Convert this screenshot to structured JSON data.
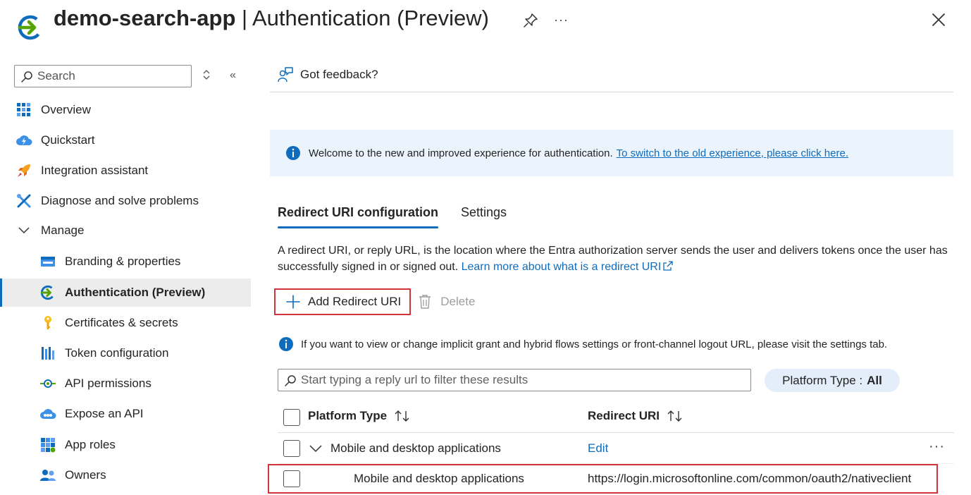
{
  "header": {
    "app_name": "demo-search-app",
    "separator": " | ",
    "page_name": "Authentication (Preview)",
    "more_label": "···"
  },
  "sidebar": {
    "search_placeholder": "Search",
    "collapse_label": "«",
    "items": [
      {
        "label": "Overview",
        "icon": "overview-grid-icon"
      },
      {
        "label": "Quickstart",
        "icon": "quickstart-cloud-icon"
      },
      {
        "label": "Integration assistant",
        "icon": "rocket-icon"
      },
      {
        "label": "Diagnose and solve problems",
        "icon": "wrench-icon"
      }
    ],
    "manage_label": "Manage",
    "manage_items": [
      {
        "label": "Branding & properties",
        "icon": "branding-icon"
      },
      {
        "label": "Authentication (Preview)",
        "icon": "authentication-icon",
        "active": true
      },
      {
        "label": "Certificates & secrets",
        "icon": "key-icon"
      },
      {
        "label": "Token configuration",
        "icon": "token-bars-icon"
      },
      {
        "label": "API permissions",
        "icon": "api-permissions-icon"
      },
      {
        "label": "Expose an API",
        "icon": "expose-api-cloud-icon"
      },
      {
        "label": "App roles",
        "icon": "app-roles-grid-icon"
      },
      {
        "label": "Owners",
        "icon": "owners-people-icon"
      }
    ]
  },
  "main": {
    "feedback_label": "Got feedback?",
    "banner": {
      "text": "Welcome to the new and improved experience for authentication.",
      "link": "To switch to the old experience, please click here."
    },
    "tabs": [
      {
        "label": "Redirect URI configuration",
        "active": true
      },
      {
        "label": "Settings",
        "active": false
      }
    ],
    "description": {
      "text": "A redirect URI, or reply URL, is the location where the Entra authorization server sends the user and delivers tokens once the user has successfully signed in or signed out.",
      "link": "Learn more about what is a redirect URI"
    },
    "commands": {
      "add_label": "Add Redirect URI",
      "delete_label": "Delete"
    },
    "info_text": "If you want to view or change implicit grant and hybrid flows settings or front-channel logout URL, please visit the settings tab.",
    "filter_placeholder": "Start typing a reply url to filter these results",
    "platform_filter": {
      "label": "Platform Type :",
      "value": "All"
    },
    "table": {
      "columns": [
        "Platform Type",
        "Redirect URI"
      ],
      "group_row": {
        "platform": "Mobile and desktop applications",
        "action": "Edit",
        "more": "···"
      },
      "rows": [
        {
          "platform": "Mobile and desktop applications",
          "uri": "https://login.microsoftonline.com/common/oauth2/nativeclient"
        }
      ]
    }
  },
  "colors": {
    "accent": "#0f6cbd",
    "highlight": "#d13438",
    "banner_bg": "#ebf3fc"
  }
}
